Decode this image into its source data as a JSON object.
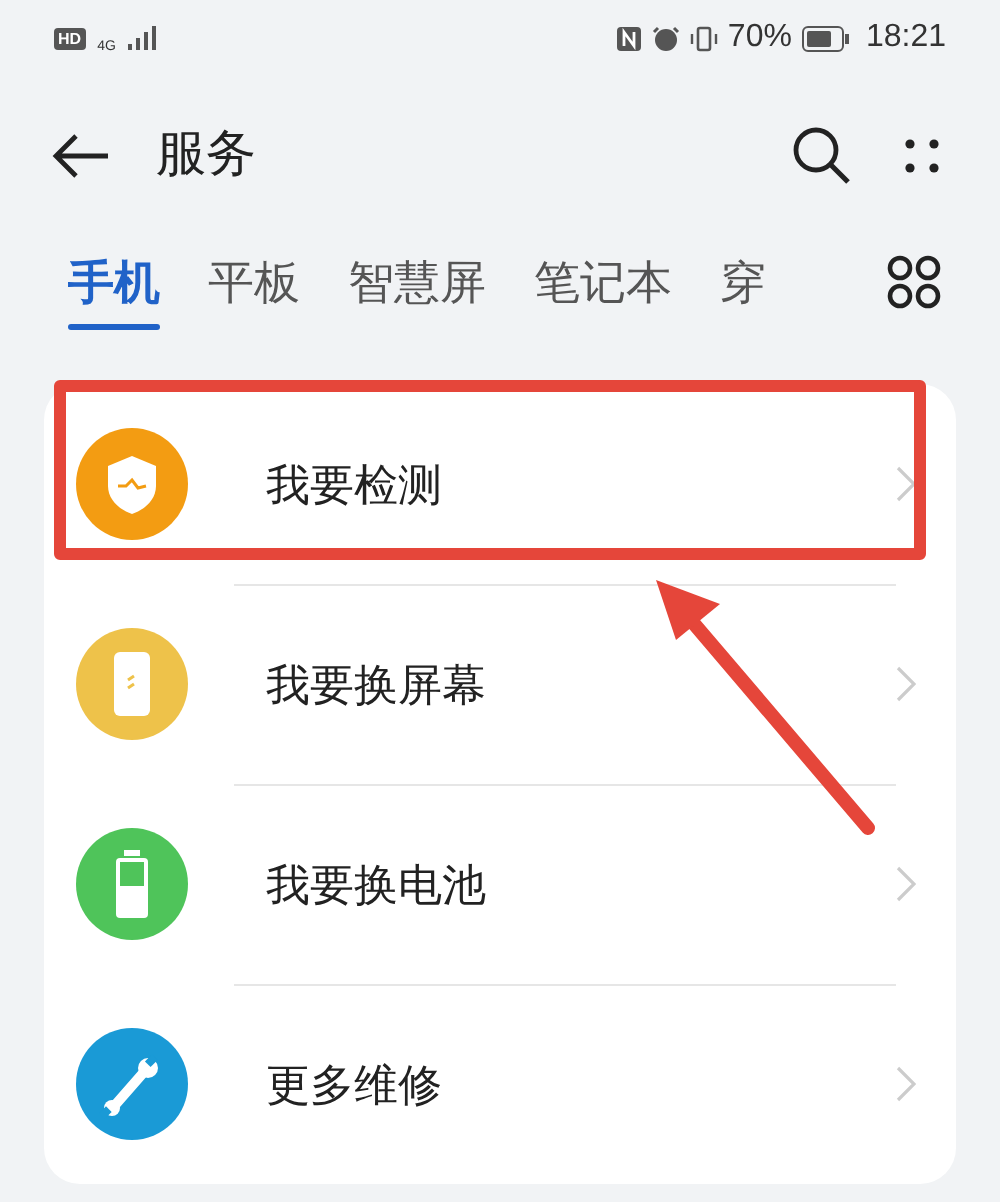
{
  "status_bar": {
    "badges": [
      "HD",
      "4G"
    ],
    "battery": "70%",
    "time": "18:21"
  },
  "header": {
    "title": "服务"
  },
  "tabs": [
    {
      "label": "手机",
      "selected": true
    },
    {
      "label": "平板",
      "selected": false
    },
    {
      "label": "智慧屏",
      "selected": false
    },
    {
      "label": "笔记本",
      "selected": false
    },
    {
      "label": "穿",
      "selected": false
    }
  ],
  "items": [
    {
      "label": "我要检测",
      "kind": "shield",
      "color": "#f39c12",
      "highlighted": true
    },
    {
      "label": "我要换屏幕",
      "kind": "phone",
      "color": "#eec24a",
      "highlighted": false
    },
    {
      "label": "我要换电池",
      "kind": "battery",
      "color": "#4fc45a",
      "highlighted": false
    },
    {
      "label": "更多维修",
      "kind": "wrench",
      "color": "#1a9ad6",
      "highlighted": false
    }
  ]
}
